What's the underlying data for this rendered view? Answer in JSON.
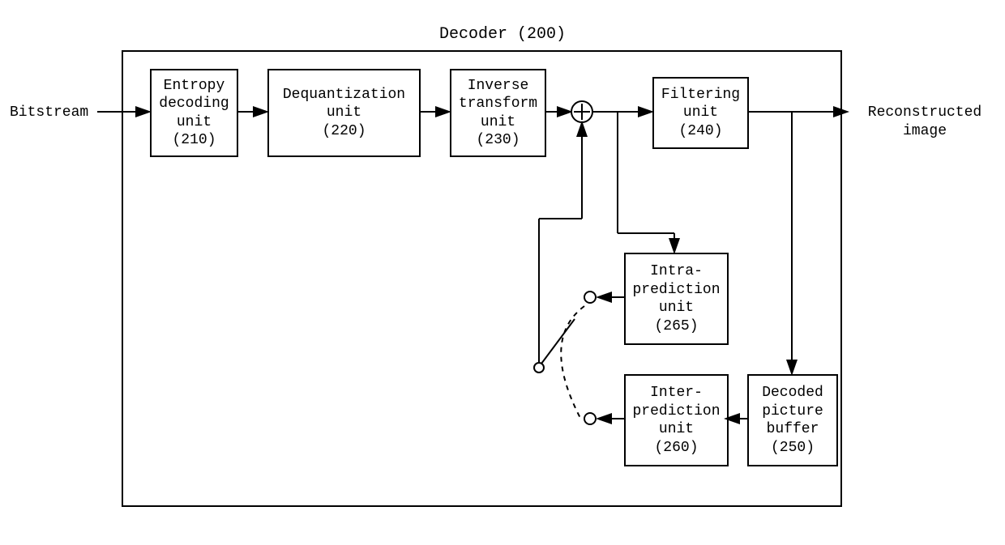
{
  "title": "Decoder (200)",
  "input_label": "Bitstream",
  "output_label": "Reconstructed\nimage",
  "blocks": {
    "b210": "Entropy\ndecoding\nunit\n(210)",
    "b220": "Dequantization\nunit\n(220)",
    "b230": "Inverse\ntransform\nunit\n(230)",
    "b240": "Filtering\nunit\n(240)",
    "b265": "Intra-\nprediction\nunit\n(265)",
    "b260": "Inter-\nprediction\nunit\n(260)",
    "b250": "Decoded\npicture\nbuffer\n(250)"
  }
}
